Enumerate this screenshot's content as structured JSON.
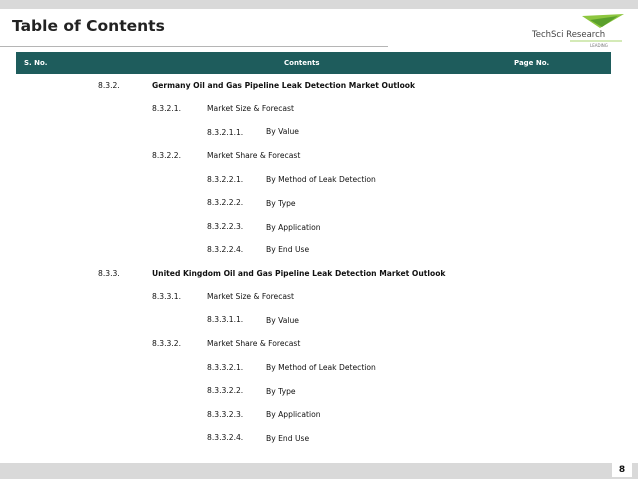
{
  "page": {
    "title": "Table of Contents",
    "page_number": "8"
  },
  "logo": {
    "name": "TechSci Research",
    "colors": {
      "green": "#8dc63f",
      "teal": "#1e5c5c"
    }
  },
  "header": {
    "sno": "S. No.",
    "contents": "Contents",
    "page": "Page No."
  },
  "colors": {
    "header_bg": "#1e5c5c",
    "bar": "#d9d9d9"
  },
  "rows": [
    {
      "num": "8.3.2.",
      "text": "Germany Oil and Gas Pipeline Leak Detection Market Outlook"
    },
    {
      "num": "8.3.2.1.",
      "text": "Market Size & Forecast"
    },
    {
      "num": "8.3.2.1.1.",
      "text": "By Value"
    },
    {
      "num": "8.3.2.2.",
      "text": "Market Share & Forecast"
    },
    {
      "num": "8.3.2.2.1.",
      "text": "By Method of Leak Detection"
    },
    {
      "num": "8.3.2.2.2.",
      "text": "By Type"
    },
    {
      "num": "8.3.2.2.3.",
      "text": "By Application"
    },
    {
      "num": "8.3.2.2.4.",
      "text": "By End Use"
    },
    {
      "num": "8.3.3.",
      "text": "United Kingdom Oil and Gas Pipeline Leak Detection Market Outlook"
    },
    {
      "num": "8.3.3.1.",
      "text": "Market Size & Forecast"
    },
    {
      "num": "8.3.3.1.1.",
      "text": "By Value"
    },
    {
      "num": "8.3.3.2.",
      "text": "Market Share & Forecast"
    },
    {
      "num": "8.3.3.2.1.",
      "text": "By Method of Leak Detection"
    },
    {
      "num": "8.3.3.2.2.",
      "text": "By Type"
    },
    {
      "num": "8.3.3.2.3.",
      "text": "By Application"
    },
    {
      "num": "8.3.3.2.4.",
      "text": "By End Use"
    }
  ]
}
